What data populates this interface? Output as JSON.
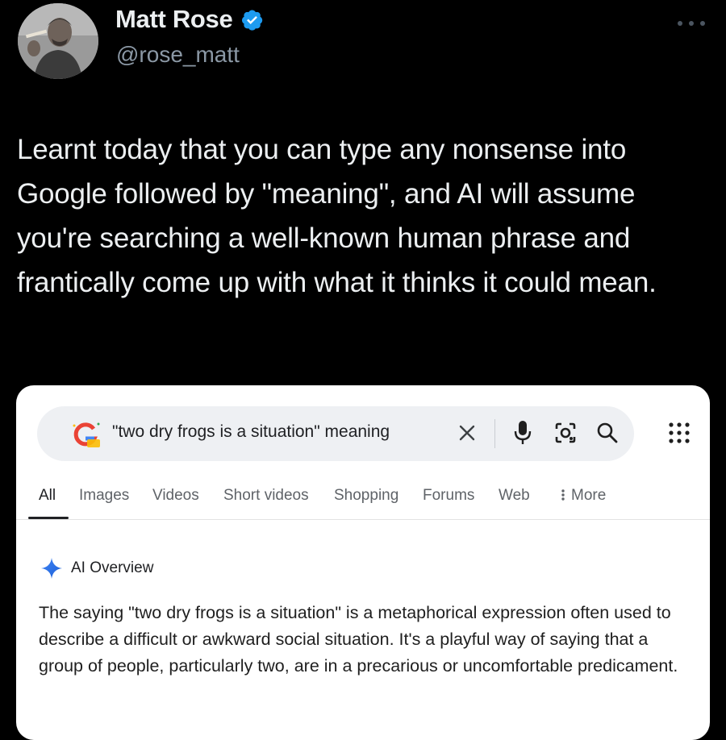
{
  "tweet": {
    "author_name": "Matt Rose",
    "handle": "@rose_matt",
    "text": "Learnt today that you can type any nonsense into Google followed by \"meaning\", and AI will assume you're searching a well-known human phrase and frantically come up with what it thinks it could mean.",
    "icons": {
      "verified": "verified-badge-icon",
      "more": "more-options-icon"
    },
    "colors": {
      "background": "#000000",
      "verified_blue": "#1d9bf0",
      "handle_gray": "#8b98a5"
    }
  },
  "google": {
    "search_query": "\"two dry frogs is a situation\" meaning",
    "icons": {
      "logo": "google-logo-icon",
      "clear": "close-icon",
      "mic": "microphone-icon",
      "lens": "lens-camera-icon",
      "search": "search-icon",
      "apps": "apps-grid-icon",
      "more_tab": "vertical-dots-icon",
      "ai": "sparkle-icon"
    },
    "tabs": [
      {
        "label": "All",
        "active": true
      },
      {
        "label": "Images"
      },
      {
        "label": "Videos"
      },
      {
        "label": "Short videos"
      },
      {
        "label": "Shopping"
      },
      {
        "label": "Forums"
      },
      {
        "label": "Web"
      },
      {
        "label": "More"
      }
    ],
    "ai_overview": {
      "label": "AI Overview",
      "text": "The saying \"two dry frogs is a situation\" is a metaphorical expression often used to describe a difficult or awkward social situation. It's a playful way of saying that a group of people, particularly two, are in a precarious or uncomfortable predicament."
    }
  }
}
